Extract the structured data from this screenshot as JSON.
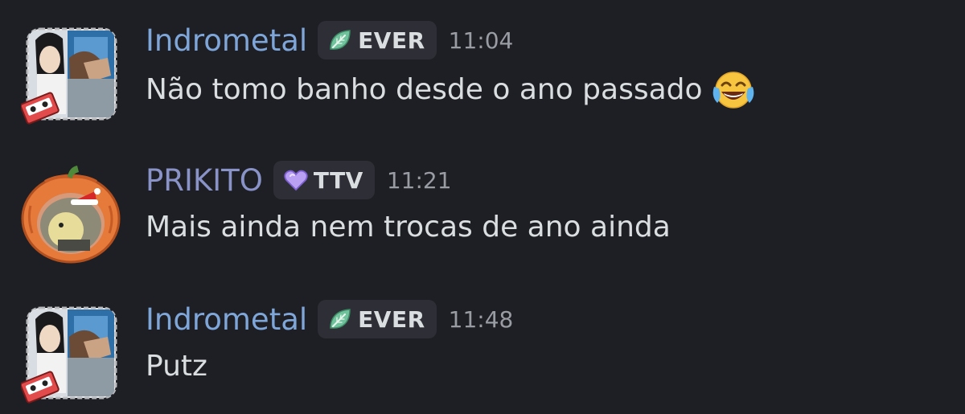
{
  "messages": [
    {
      "username": "Indrometal",
      "username_color": "#7fa6d9",
      "tag_text": "EVER",
      "tag_icon": "leaf-icon",
      "time": "11:04",
      "content": "Não tomo banho desde o ano passado",
      "emoji": "joy-emoji"
    },
    {
      "username": "PRIKITO",
      "username_color": "#8a93c7",
      "tag_text": "TTV",
      "tag_icon": "heart-icon",
      "time": "11:21",
      "content": "Mais ainda nem trocas de ano ainda"
    },
    {
      "username": "Indrometal",
      "username_color": "#7fa6d9",
      "tag_text": "EVER",
      "tag_icon": "leaf-icon",
      "time": "11:48",
      "content": "Putz"
    }
  ],
  "colors": {
    "background": "#1e1f24",
    "tag_background": "#2e2f36",
    "text": "#dbdee1",
    "timestamp": "#9a9ca4"
  }
}
